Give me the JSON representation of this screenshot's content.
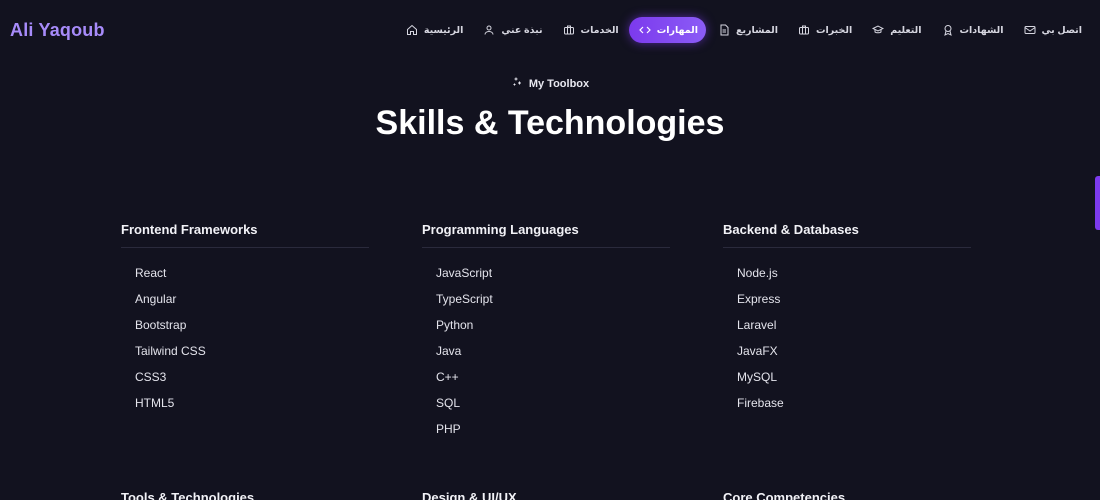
{
  "brand": {
    "logo": "Ali Yaqoub",
    "accent": "#7c3aed",
    "logo_color": "#a78bfa"
  },
  "nav": {
    "items": [
      {
        "label": "اتصل بي",
        "icon": "mail-icon",
        "active": false
      },
      {
        "label": "الشهادات",
        "icon": "award-icon",
        "active": false
      },
      {
        "label": "التعليم",
        "icon": "graduation-cap-icon",
        "active": false
      },
      {
        "label": "الخبرات",
        "icon": "briefcase-icon",
        "active": false
      },
      {
        "label": "المشاريع",
        "icon": "file-icon",
        "active": false
      },
      {
        "label": "المهارات",
        "icon": "code-icon",
        "active": true
      },
      {
        "label": "الخدمات",
        "icon": "briefcase-icon",
        "active": false
      },
      {
        "label": "نبذة عني",
        "icon": "user-icon",
        "active": false
      },
      {
        "label": "الرئيسية",
        "icon": "home-icon",
        "active": false
      }
    ]
  },
  "hero": {
    "eyebrow": "My Toolbox",
    "eyebrow_icon": "sparkles-icon",
    "title": "Skills & Technologies"
  },
  "categories": [
    {
      "title": "Frontend Frameworks",
      "skills": [
        "React",
        "Angular",
        "Bootstrap",
        "Tailwind CSS",
        "CSS3",
        "HTML5"
      ]
    },
    {
      "title": "Programming Languages",
      "skills": [
        "JavaScript",
        "TypeScript",
        "Python",
        "Java",
        "C++",
        "SQL",
        "PHP"
      ]
    },
    {
      "title": "Backend & Databases",
      "skills": [
        "Node.js",
        "Express",
        "Laravel",
        "JavaFX",
        "MySQL",
        "Firebase"
      ]
    },
    {
      "title": "Tools & Technologies",
      "skills": []
    },
    {
      "title": "Design & UI/UX",
      "skills": []
    },
    {
      "title": "Core Competencies",
      "skills": []
    }
  ]
}
